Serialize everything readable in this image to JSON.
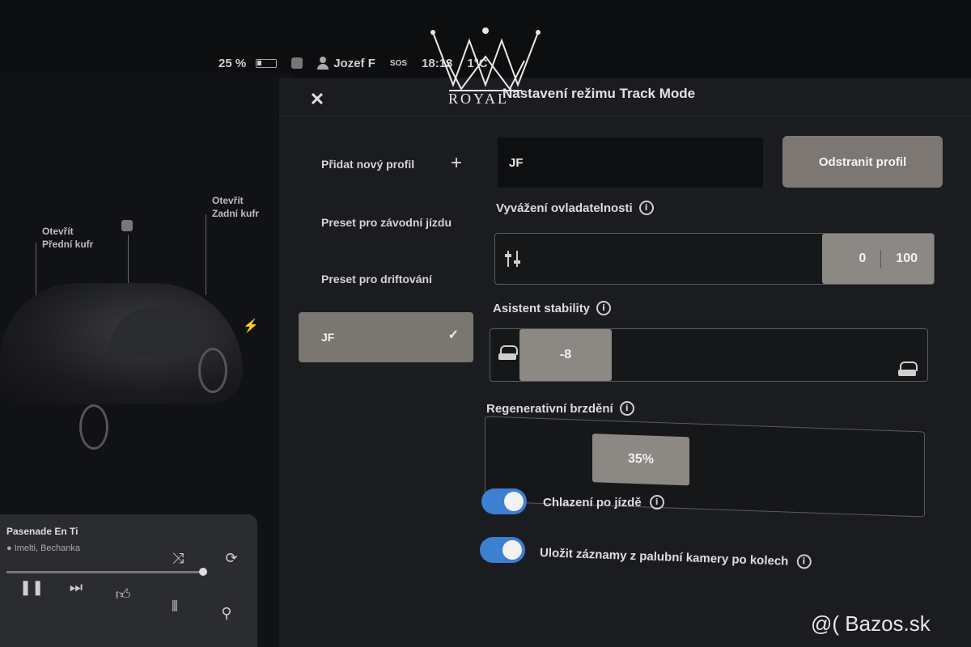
{
  "status": {
    "battery_percent": "25 %",
    "user_name": "Jozef F",
    "sos": "SOS",
    "time": "18:13",
    "temperature": "1°C"
  },
  "car": {
    "front_trunk_label": "Otevřít\nPřední kufr",
    "rear_trunk_label": "Otevřít\nZadní kufr"
  },
  "media": {
    "title": "Pasenade En Ti",
    "artist": "● Imelti, Bechanka",
    "controls": [
      "shuffle-icon",
      "repeat-icon",
      "pause-icon",
      "next-icon",
      "like-icon",
      "equalizer-icon",
      "search-icon"
    ]
  },
  "modal": {
    "title": "Nastavení režimu Track Mode",
    "close_icon": "close-icon",
    "profiles": [
      {
        "label": "Přidat nový profil",
        "action": "+"
      },
      {
        "label": "Preset pro závodní jízdu"
      },
      {
        "label": "Preset pro driftování"
      },
      {
        "label": "JF",
        "selected": true
      }
    ],
    "profile_name_value": "JF",
    "delete_button": "Odstranit profil",
    "handling_balance": {
      "label": "Vyvážení ovladatelnosti",
      "front_value": "0",
      "rear_value": "100"
    },
    "stability_assist": {
      "label": "Asistent stability",
      "value": "-8"
    },
    "regen_braking": {
      "label": "Regenerativní brzdění",
      "value": "35%"
    },
    "post_drive_cooling": {
      "label": "Chlazení po jízdě",
      "on": true
    },
    "dashcam_laps": {
      "label": "Uložit záznamy z palubní kamery po kolech",
      "on": true
    }
  },
  "overlay": {
    "logo_text": "ROYAL",
    "watermark": "@( Bazos.sk"
  },
  "colors": {
    "toggle_on": "#3d7fd1",
    "selected_profile": "#7a7670",
    "slider_fill": "#8c8985"
  }
}
